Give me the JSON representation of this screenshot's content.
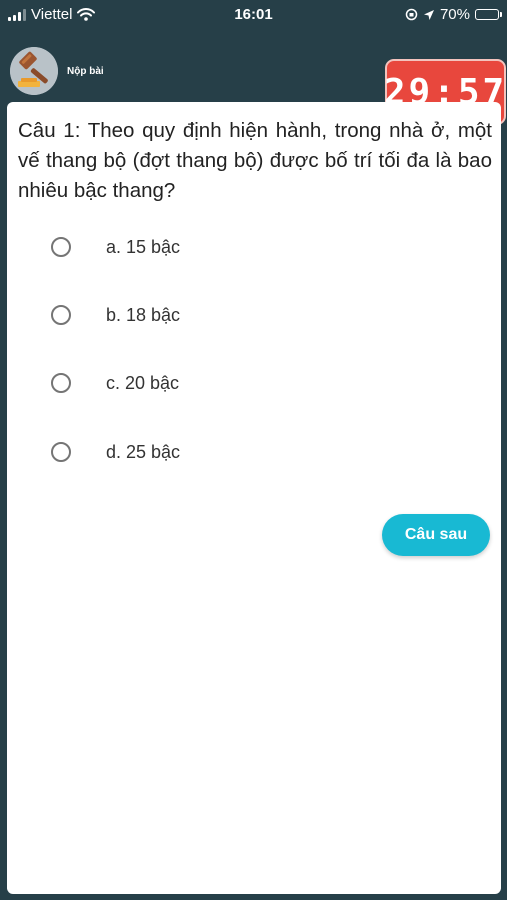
{
  "status_bar": {
    "carrier": "Viettel",
    "time": "16:01",
    "battery": "70%"
  },
  "header": {
    "submit_label": "Nộp bài",
    "timer": "29:57"
  },
  "quiz": {
    "question": "Câu 1: Theo quy định hiện hành, trong nhà ở, một vế thang bộ (đợt thang bộ) được bố trí tối đa là bao nhiêu bậc thang?",
    "options": [
      {
        "label": "a. 15 bậc"
      },
      {
        "label": "b. 18 bậc"
      },
      {
        "label": "c. 20 bậc"
      },
      {
        "label": "d. 25 bậc"
      }
    ],
    "next_label": "Câu sau"
  },
  "colors": {
    "background": "#263f48",
    "timer": "#e8473d",
    "next_button": "#18b9d3"
  }
}
